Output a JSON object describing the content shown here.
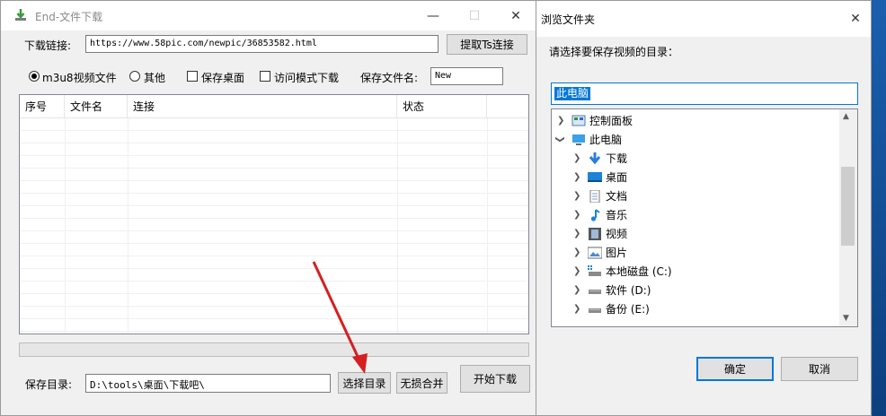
{
  "main_window": {
    "title": "End-文件下载",
    "url_label": "下载链接:",
    "url_value": "https://www.58pic.com/newpic/36853582.html",
    "extract_button": "提取Ts连接",
    "radio_m3u8": "m3u8视频文件",
    "radio_other": "其他",
    "check_save_desktop": "保存桌面",
    "check_access_mode": "访问模式下载",
    "filename_label": "保存文件名:",
    "filename_value": "New",
    "columns": [
      "序号",
      "文件名",
      "连接",
      "状态"
    ],
    "save_dir_label": "保存目录:",
    "save_dir_value": "D:\\tools\\桌面\\下载吧\\",
    "select_dir_button": "选择目录",
    "lossless_merge_button": "无损合并",
    "start_download_button": "开始下载",
    "progress": 0
  },
  "folder_dialog": {
    "title": "浏览文件夹",
    "prompt": "请选择要保存视频的目录：",
    "selected_path": "此电脑",
    "tree": [
      {
        "label": "控制面板",
        "icon": "control-panel-icon",
        "level": 0,
        "chevron": "right"
      },
      {
        "label": "此电脑",
        "icon": "computer-icon",
        "level": 0,
        "chevron": "down"
      },
      {
        "label": "下载",
        "icon": "download-arrow-icon",
        "level": 1,
        "chevron": "right"
      },
      {
        "label": "桌面",
        "icon": "desktop-icon",
        "level": 1,
        "chevron": "right"
      },
      {
        "label": "文档",
        "icon": "document-icon",
        "level": 1,
        "chevron": "right"
      },
      {
        "label": "音乐",
        "icon": "music-icon",
        "level": 1,
        "chevron": "right"
      },
      {
        "label": "视频",
        "icon": "video-icon",
        "level": 1,
        "chevron": "right"
      },
      {
        "label": "图片",
        "icon": "picture-icon",
        "level": 1,
        "chevron": "right"
      },
      {
        "label": "本地磁盘 (C:)",
        "icon": "system-drive-icon",
        "level": 1,
        "chevron": "right"
      },
      {
        "label": "软件 (D:)",
        "icon": "drive-icon",
        "level": 1,
        "chevron": "right"
      },
      {
        "label": "备份 (E:)",
        "icon": "drive-icon",
        "level": 1,
        "chevron": "right"
      }
    ],
    "ok_button": "确定",
    "cancel_button": "取消"
  },
  "colors": {
    "accent": "#0078d7",
    "annotation_arrow": "#d42020"
  }
}
